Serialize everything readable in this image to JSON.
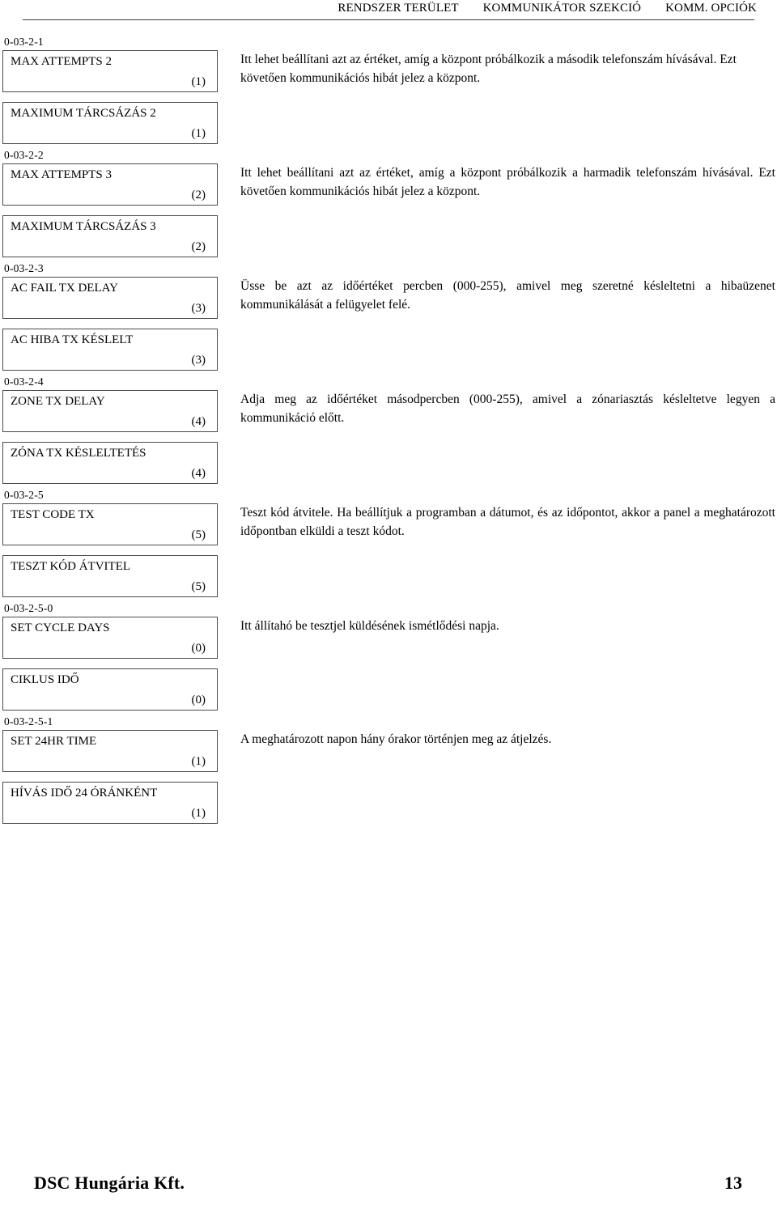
{
  "header": {
    "items": [
      "RENDSZER TERÜLET",
      "KOMMUNIKÁTOR SZEKCIÓ",
      "KOMM. OPCIÓK"
    ]
  },
  "entries": [
    {
      "code": "0-03-2-1",
      "english": {
        "title": "MAX ATTEMPTS 2",
        "value": "(1)"
      },
      "hungarian": {
        "title": "MAXIMUM TÁRCSÁZÁS 2",
        "value": "(1)"
      },
      "description": "Itt lehet beállítani azt az értéket, amíg a központ próbálkozik a második telefonszám hívásával. Ezt követően kommunikációs hibát jelez a központ."
    },
    {
      "code": "0-03-2-2",
      "english": {
        "title": "MAX ATTEMPTS 3",
        "value": "(2)"
      },
      "hungarian": {
        "title": "MAXIMUM TÁRCSÁZÁS 3",
        "value": "(2)"
      },
      "description": "Itt lehet beállítani azt az értéket, amíg a központ próbálkozik a harmadik telefonszám hívásával. Ezt követően kommunikációs hibát jelez a központ."
    },
    {
      "code": "0-03-2-3",
      "english": {
        "title": "AC FAIL TX DELAY",
        "value": "(3)"
      },
      "hungarian": {
        "title": "AC HIBA TX KÉSLELT",
        "value": "(3)"
      },
      "description": "Üsse be azt az időértéket percben (000-255), amivel meg szeretné késleltetni a hibaüzenet kommunikálását a felügyelet felé."
    },
    {
      "code": "0-03-2-4",
      "english": {
        "title": "ZONE TX DELAY",
        "value": "(4)"
      },
      "hungarian": {
        "title": "ZÓNA TX KÉSLELTETÉS",
        "value": "(4)"
      },
      "description": "Adja meg az időértéket másodpercben (000-255), amivel a zónariasztás késleltetve legyen a kommunikáció előtt."
    },
    {
      "code": "0-03-2-5",
      "english": {
        "title": "TEST CODE TX",
        "value": "(5)"
      },
      "hungarian": {
        "title": "TESZT KÓD ÁTVITEL",
        "value": "(5)"
      },
      "description": "Teszt kód átvitele. Ha beállítjuk a programban a dátumot, és az időpontot, akkor a panel a meghatározott időpontban elküldi a teszt kódot."
    },
    {
      "code": "0-03-2-5-0",
      "english": {
        "title": "SET CYCLE DAYS",
        "value": "(0)"
      },
      "hungarian": {
        "title": "CIKLUS IDŐ",
        "value": "(0)"
      },
      "description": "Itt állítahó be tesztjel küldésének ismétlődési napja."
    },
    {
      "code": "0-03-2-5-1",
      "english": {
        "title": "SET 24HR TIME",
        "value": "(1)"
      },
      "hungarian": {
        "title": "HÍVÁS IDŐ 24 ÓRÁNKÉNT",
        "value": "(1)"
      },
      "description": "A meghatározott napon hány órakor történjen meg az átjelzés."
    }
  ],
  "footer": {
    "company": "DSC Hungária Kft.",
    "page_number": "13"
  }
}
